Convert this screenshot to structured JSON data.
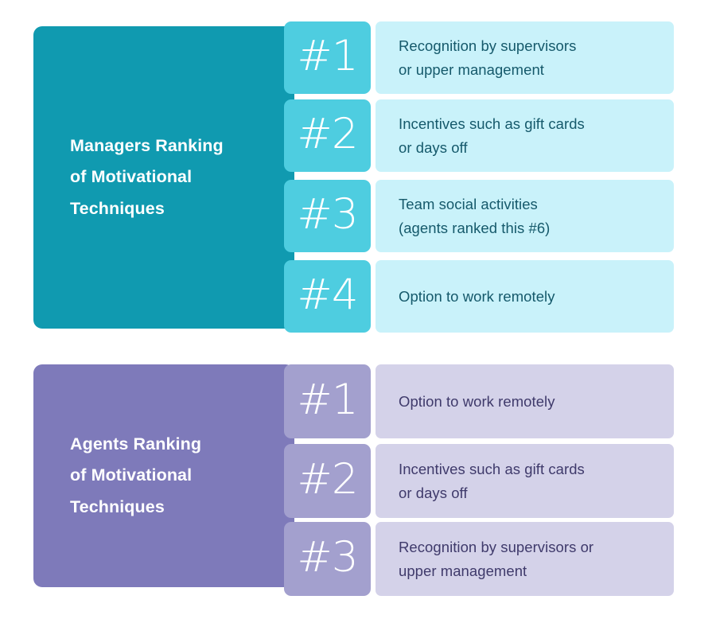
{
  "colors": {
    "teal_panel": "#109ab0",
    "teal_badge": "#4ecde0",
    "teal_card": "#c9f2fa",
    "teal_text": "#15596b",
    "purple_panel": "#7e7aba",
    "purple_badge": "#a3a0ce",
    "purple_card": "#d4d2e9",
    "purple_text": "#3f3a6b",
    "background": "#ffffff"
  },
  "sections": {
    "managers": {
      "title": "Managers Ranking\nof Motivational\nTechniques",
      "items": [
        {
          "rank": "#1",
          "text": "Recognition by supervisors\nor upper management"
        },
        {
          "rank": "#2",
          "text": "Incentives such as gift cards\nor days off"
        },
        {
          "rank": "#3",
          "text": "Team social activities\n(agents ranked this #6)"
        },
        {
          "rank": "#4",
          "text": "Option to work remotely"
        }
      ]
    },
    "agents": {
      "title": "Agents Ranking\nof Motivational\nTechniques",
      "items": [
        {
          "rank": "#1",
          "text": "Option to work remotely"
        },
        {
          "rank": "#2",
          "text": "Incentives such as gift cards\nor days off"
        },
        {
          "rank": "#3",
          "text": "Recognition by supervisors or\nupper management"
        }
      ]
    }
  }
}
